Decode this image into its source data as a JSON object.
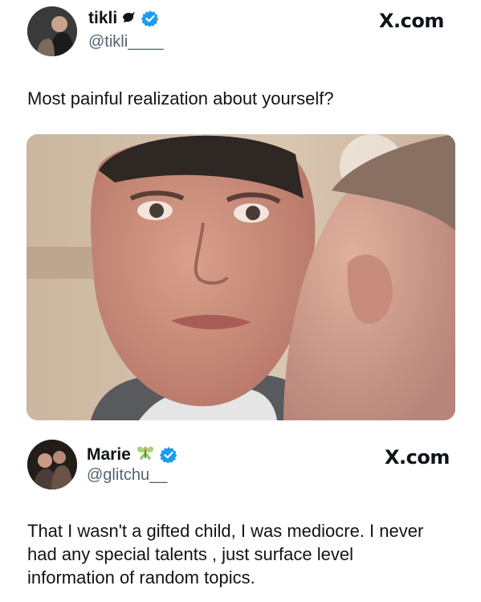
{
  "post1": {
    "name": "tikli",
    "name_emoji": "🐦",
    "handle": "@tikli____",
    "brand": "X.com",
    "text": "Most painful realization about yourself?",
    "media_alt": "Photo of a tearful man as another man whispers in his ear"
  },
  "post2": {
    "name": "Marie",
    "name_emoji": "🧚",
    "handle": "@glitchu__",
    "brand": "X.com",
    "text": "That I wasn't a gifted child, I was mediocre. I never had any special talents , just surface level information of random topics."
  },
  "colors": {
    "verified": "#1d9bf0",
    "handle": "#536471",
    "text": "#0f1419"
  },
  "icons": [
    "avatar",
    "bird-emoji-icon",
    "verified-badge-icon",
    "fairy-emoji-icon"
  ]
}
